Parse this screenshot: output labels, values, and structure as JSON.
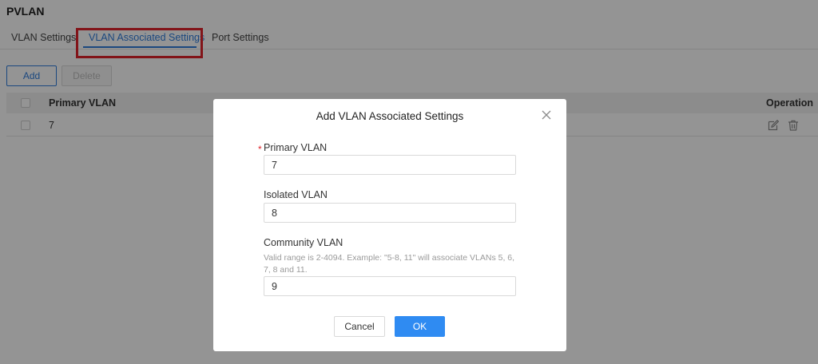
{
  "page": {
    "title": "PVLAN"
  },
  "tabs": [
    {
      "label": "VLAN Settings",
      "active": false
    },
    {
      "label": "VLAN Associated Settings",
      "active": true
    },
    {
      "label": "Port Settings",
      "active": false
    }
  ],
  "toolbar": {
    "add_label": "Add",
    "delete_label": "Delete"
  },
  "table": {
    "columns": {
      "primary_vlan": "Primary VLAN",
      "operation": "Operation"
    },
    "rows": [
      {
        "primary_vlan": "7"
      }
    ]
  },
  "modal": {
    "title": "Add VLAN Associated Settings",
    "primary_vlan": {
      "label": "Primary VLAN",
      "required_mark": "*",
      "value": "7"
    },
    "isolated_vlan": {
      "label": "Isolated VLAN",
      "value": "8"
    },
    "community_vlan": {
      "label": "Community VLAN",
      "hint": "Valid range is 2-4094. Example: \"5-8, 11\" will associate VLANs 5, 6, 7, 8 and 11.",
      "value": "9"
    },
    "cancel_label": "Cancel",
    "ok_label": "OK"
  },
  "colors": {
    "accent": "#2f7ddb",
    "primary_button": "#2f8bf2",
    "highlight": "#e0242c",
    "required": "#e0242c"
  },
  "icons": {
    "edit": "edit-icon",
    "delete": "trash-icon",
    "close": "close-icon"
  }
}
